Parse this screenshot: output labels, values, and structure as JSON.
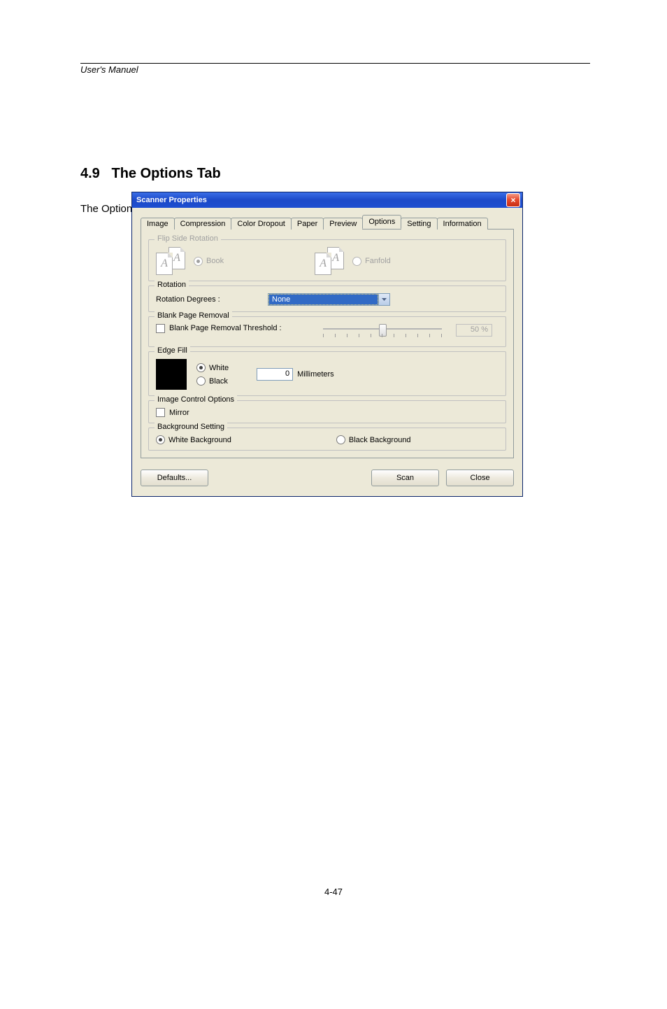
{
  "page": {
    "header_left": "User's Manuel",
    "section_number": "4.9",
    "section_title": "The Options Tab",
    "section_body": "The Options tab allows you to set following additional image processing settings.",
    "footer": "4-47"
  },
  "dialog": {
    "title": "Scanner Properties",
    "tabs": [
      "Image",
      "Compression",
      "Color Dropout",
      "Paper",
      "Preview",
      "Options",
      "Setting",
      "Information"
    ],
    "active_tab": "Options",
    "flip_side_rotation": {
      "legend": "Flip Side Rotation",
      "book": "Book",
      "fanfold": "Fanfold",
      "selected": "book",
      "disabled": true
    },
    "rotation": {
      "legend": "Rotation",
      "label": "Rotation Degrees :",
      "value": "None"
    },
    "blank_page": {
      "legend": "Blank Page Removal",
      "checkbox_label": "Blank Page Removal Threshold :",
      "checked": false,
      "percent": "50 %"
    },
    "edge_fill": {
      "legend": "Edge Fill",
      "white": "White",
      "black": "Black",
      "selected": "white",
      "value": "0",
      "unit": "Millimeters"
    },
    "image_control": {
      "legend": "Image Control Options",
      "mirror": "Mirror",
      "mirror_checked": false
    },
    "background": {
      "legend": "Background Setting",
      "white": "White Background",
      "black": "Black Background",
      "selected": "white"
    },
    "buttons": {
      "defaults": "Defaults...",
      "scan": "Scan",
      "close": "Close"
    }
  }
}
